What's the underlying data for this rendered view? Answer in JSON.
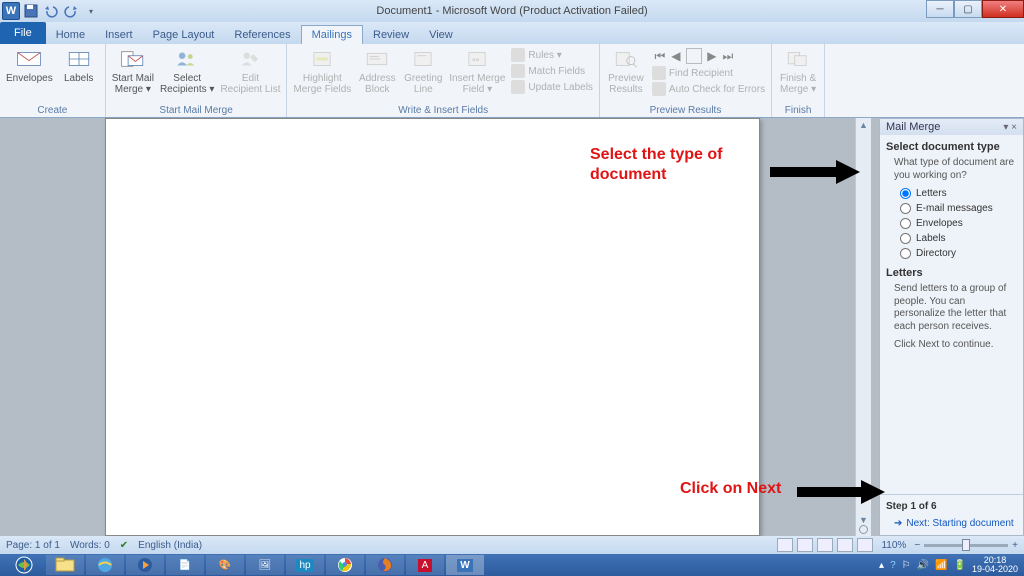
{
  "title": "Document1 - Microsoft Word (Product Activation Failed)",
  "qat_logo": "W",
  "tabs": {
    "file": "File",
    "home": "Home",
    "insert": "Insert",
    "page_layout": "Page Layout",
    "references": "References",
    "mailings": "Mailings",
    "review": "Review",
    "view": "View"
  },
  "ribbon": {
    "create": {
      "label": "Create",
      "envelopes": "Envelopes",
      "labels": "Labels"
    },
    "start": {
      "label": "Start Mail Merge",
      "start_mail": "Start Mail\nMerge ▾",
      "select_recip": "Select\nRecipients ▾",
      "edit_recip": "Edit\nRecipient List"
    },
    "write": {
      "label": "Write & Insert Fields",
      "highlight": "Highlight\nMerge Fields",
      "address": "Address\nBlock",
      "greeting": "Greeting\nLine",
      "insert_field": "Insert Merge\nField ▾",
      "rules": "Rules ▾",
      "match": "Match Fields",
      "update": "Update Labels"
    },
    "preview": {
      "label": "Preview Results",
      "preview": "Preview\nResults",
      "find": "Find Recipient",
      "auto": "Auto Check for Errors"
    },
    "finish": {
      "label": "Finish",
      "finish": "Finish &\nMerge ▾"
    }
  },
  "pane": {
    "title": "Mail Merge",
    "close": "▾ ×",
    "section1": "Select document type",
    "q": "What type of document are you working on?",
    "opts": [
      "Letters",
      "E-mail messages",
      "Envelopes",
      "Labels",
      "Directory"
    ],
    "section2": "Letters",
    "desc": "Send letters to a group of people. You can personalize the letter that each person receives.",
    "cont": "Click Next to continue.",
    "step": "Step 1 of 6",
    "next": "Next: Starting document"
  },
  "status": {
    "page": "Page: 1 of 1",
    "words": "Words: 0",
    "lang": "English (India)",
    "zoom": "110%"
  },
  "clock": {
    "time": "20:18",
    "date": "19-04-2020"
  },
  "anno": {
    "a1": "Select the type of document",
    "a2": "Click on Next"
  }
}
